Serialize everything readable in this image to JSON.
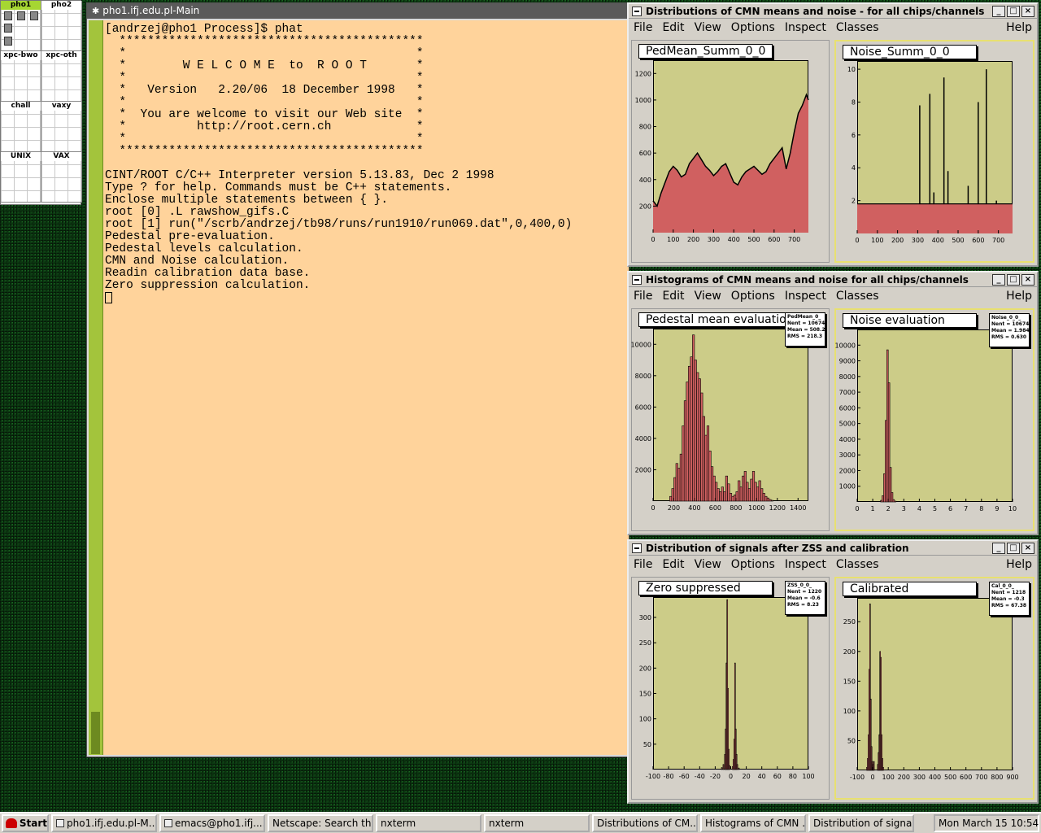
{
  "pager": {
    "cells": [
      {
        "label": "pho1",
        "active": true
      },
      {
        "label": "pho2"
      },
      {
        "label": "xpc-bwo"
      },
      {
        "label": "xpc-oth"
      },
      {
        "label": "chall"
      },
      {
        "label": "vaxy"
      },
      {
        "label": "UNIX"
      },
      {
        "label": "VAX"
      }
    ]
  },
  "terminal": {
    "title": "pho1.ifj.edu.pl-Main",
    "lines": [
      "[andrzej@pho1 Process]$ phat",
      "  *******************************************",
      "  *                                         *",
      "  *        W E L C O M E  to  R O O T       *",
      "  *                                         *",
      "  *   Version   2.20/06  18 December 1998   *",
      "  *                                         *",
      "  *  You are welcome to visit our Web site  *",
      "  *          http://root.cern.ch            *",
      "  *                                         *",
      "  *******************************************",
      "",
      "CINT/ROOT C/C++ Interpreter version 5.13.83, Dec 2 1998",
      "Type ? for help. Commands must be C++ statements.",
      "Enclose multiple statements between { }.",
      "root [0] .L rawshow_gifs.C",
      "root [1] run(\"/scrb/andrzej/tb98/runs/run1910/run069.dat\",0,400,0)",
      "Pedestal pre-evaluation.",
      "Pedestal levels calculation.",
      "CMN and Noise calculation.",
      "Readin calibration data base.",
      "Zero suppression calculation."
    ]
  },
  "menu": {
    "items": [
      "File",
      "Edit",
      "View",
      "Options",
      "Inspect",
      "Classes"
    ],
    "help": "Help"
  },
  "window_buttons": {
    "minimize": "_",
    "maximize": "□",
    "close": "×"
  },
  "colors": {
    "frame_fill": "#cccc88",
    "histogram_fill": "#d06060",
    "histogram_line": "#000000",
    "terminal_bg": "#ffd39b",
    "scrollbar": "#a3c43c",
    "pager_active": "#a6d632"
  },
  "windows": [
    {
      "title": "Distributions of CMN means and noise - for all chips/channels",
      "pads": [
        {
          "title": "PedMean_Summ_0_0",
          "stats": null
        },
        {
          "title": "Noise_Summ_0_0",
          "stats": null
        }
      ]
    },
    {
      "title": "Histograms of CMN means and noise for all chips/channels",
      "pads": [
        {
          "title": "Pedestal mean evaluation",
          "stats": [
            "PedMean_0_",
            "Nent = 10674",
            "Mean = 508.2",
            "RMS = 218.3"
          ]
        },
        {
          "title": "Noise evaluation",
          "stats": [
            "Noise_0_0_",
            "Nent = 10674",
            "Mean = 1.984",
            "RMS = 0.630"
          ]
        }
      ]
    },
    {
      "title": "Distribution of signals after ZSS and calibration",
      "pads": [
        {
          "title": "Zero suppressed",
          "stats": [
            "ZSS_0_0_",
            "Nent = 1220",
            "Mean = -0.6",
            "RMS = 8.23"
          ]
        },
        {
          "title": "Calibrated",
          "stats": [
            "Cal_0_0_",
            "Nent = 1218",
            "Mean = -0.3",
            "RMS = 67.38"
          ]
        }
      ]
    }
  ],
  "chart_data": [
    {
      "type": "area",
      "title": "PedMean_Summ_0_0",
      "xlabel": "",
      "ylabel": "",
      "xlim": [
        0,
        770
      ],
      "ylim": [
        0,
        1300
      ],
      "x_ticks": [
        "0",
        "100",
        "200",
        "300",
        "400",
        "500",
        "600",
        "700"
      ],
      "y_ticks": [
        "200",
        "400",
        "600",
        "800",
        "1000",
        "1200"
      ],
      "x": [
        0,
        20,
        40,
        60,
        80,
        100,
        120,
        140,
        160,
        180,
        200,
        220,
        240,
        260,
        280,
        300,
        320,
        340,
        360,
        380,
        400,
        420,
        440,
        460,
        480,
        500,
        520,
        540,
        560,
        580,
        600,
        620,
        640,
        660,
        680,
        700,
        720,
        740,
        760,
        770
      ],
      "values": [
        240,
        200,
        300,
        380,
        460,
        500,
        470,
        420,
        440,
        520,
        560,
        600,
        550,
        500,
        470,
        430,
        460,
        500,
        520,
        450,
        380,
        360,
        420,
        460,
        480,
        500,
        470,
        440,
        460,
        520,
        560,
        600,
        640,
        480,
        600,
        760,
        900,
        960,
        1040,
        1000
      ]
    },
    {
      "type": "area",
      "title": "Noise_Summ_0_0",
      "xlabel": "",
      "ylabel": "",
      "xlim": [
        0,
        770
      ],
      "ylim": [
        0,
        10.5
      ],
      "x_ticks": [
        "0",
        "100",
        "200",
        "300",
        "400",
        "500",
        "600",
        "700"
      ],
      "y_ticks": [
        "2",
        "4",
        "6",
        "8",
        "10"
      ],
      "baseline": 1.8,
      "spikes": [
        [
          310,
          7.8
        ],
        [
          360,
          8.5
        ],
        [
          380,
          2.5
        ],
        [
          430,
          9.5
        ],
        [
          450,
          3.8
        ],
        [
          550,
          2.9
        ],
        [
          600,
          8.0
        ],
        [
          640,
          10.0
        ],
        [
          690,
          2.0
        ]
      ]
    },
    {
      "type": "bar",
      "title": "Pedestal mean evaluation",
      "xlabel": "",
      "ylabel": "",
      "xlim": [
        0,
        1500
      ],
      "ylim": [
        0,
        11000
      ],
      "x_ticks": [
        "0",
        "200",
        "400",
        "600",
        "800",
        "1000",
        "1200",
        "1400"
      ],
      "y_ticks": [
        "2000",
        "4000",
        "6000",
        "8000",
        "10000"
      ],
      "bin_width": 20,
      "x": [
        160,
        180,
        200,
        220,
        240,
        260,
        280,
        300,
        320,
        340,
        360,
        380,
        400,
        420,
        440,
        460,
        480,
        500,
        520,
        540,
        560,
        580,
        600,
        620,
        640,
        660,
        680,
        700,
        720,
        740,
        760,
        780,
        800,
        820,
        840,
        860,
        880,
        900,
        920,
        940,
        960,
        980,
        1000,
        1020,
        1040,
        1060,
        1080,
        1100,
        1120,
        1140
      ],
      "values": [
        300,
        800,
        1500,
        2400,
        2100,
        3000,
        4800,
        6400,
        7600,
        8600,
        9200,
        10600,
        9000,
        8200,
        7800,
        6900,
        5400,
        4200,
        4800,
        3200,
        2200,
        1600,
        1200,
        800,
        600,
        900,
        600,
        1600,
        1100,
        500,
        300,
        400,
        600,
        1300,
        900,
        1600,
        1900,
        1200,
        800,
        1400,
        1900,
        1200,
        900,
        1300,
        800,
        500,
        300,
        200,
        100,
        50
      ]
    },
    {
      "type": "bar",
      "title": "Noise evaluation",
      "xlabel": "",
      "ylabel": "",
      "xlim": [
        0,
        10
      ],
      "ylim": [
        0,
        11000
      ],
      "x_ticks": [
        "0",
        "1",
        "2",
        "3",
        "4",
        "5",
        "6",
        "7",
        "8",
        "9",
        "10"
      ],
      "y_ticks": [
        "1000",
        "2000",
        "3000",
        "4000",
        "5000",
        "6000",
        "7000",
        "8000",
        "9000",
        "10000"
      ],
      "bin_width": 0.1,
      "x": [
        1.5,
        1.6,
        1.7,
        1.8,
        1.9,
        2.0,
        2.1,
        2.2,
        2.3,
        2.4
      ],
      "values": [
        100,
        400,
        1800,
        5200,
        9700,
        7600,
        2200,
        600,
        150,
        50
      ]
    },
    {
      "type": "bar",
      "title": "Zero suppressed",
      "xlabel": "",
      "ylabel": "",
      "xlim": [
        -100,
        100
      ],
      "ylim": [
        0,
        340
      ],
      "x_ticks": [
        "-100",
        "-80",
        "-60",
        "-40",
        "-20",
        "0",
        "20",
        "40",
        "60",
        "80",
        "100"
      ],
      "y_ticks": [
        "50",
        "100",
        "150",
        "200",
        "250",
        "300"
      ],
      "bin_width": 1,
      "x": [
        -12,
        -10,
        -8,
        -7,
        -6,
        -5,
        -4,
        -3,
        -2,
        2,
        3,
        4,
        5,
        6,
        7,
        8,
        10
      ],
      "values": [
        4,
        10,
        30,
        80,
        210,
        335,
        160,
        40,
        8,
        6,
        20,
        60,
        210,
        80,
        30,
        10,
        3
      ]
    },
    {
      "type": "bar",
      "title": "Calibrated",
      "xlabel": "",
      "ylabel": "",
      "xlim": [
        -100,
        900
      ],
      "ylim": [
        0,
        290
      ],
      "x_ticks": [
        "-100",
        "0",
        "100",
        "200",
        "300",
        "400",
        "500",
        "600",
        "700",
        "800",
        "900"
      ],
      "y_ticks": [
        "50",
        "100",
        "150",
        "200",
        "250"
      ],
      "bin_width": 5,
      "x": [
        -40,
        -35,
        -30,
        -25,
        -20,
        -15,
        -10,
        -5,
        0,
        5,
        30,
        35,
        40,
        45,
        50,
        55,
        60,
        65
      ],
      "values": [
        5,
        20,
        60,
        170,
        280,
        120,
        40,
        15,
        10,
        15,
        10,
        30,
        60,
        200,
        190,
        60,
        20,
        5
      ]
    }
  ],
  "taskbar": {
    "start": "Start",
    "tasks": [
      "pho1.ifj.edu.pl-M...",
      "emacs@pho1.ifj....",
      "Netscape: Search th...",
      "nxterm",
      "nxterm",
      "Distributions of CM...",
      "Histograms of CMN ...",
      "Distribution of signal..."
    ],
    "clock": "Mon March 15 10:54"
  }
}
